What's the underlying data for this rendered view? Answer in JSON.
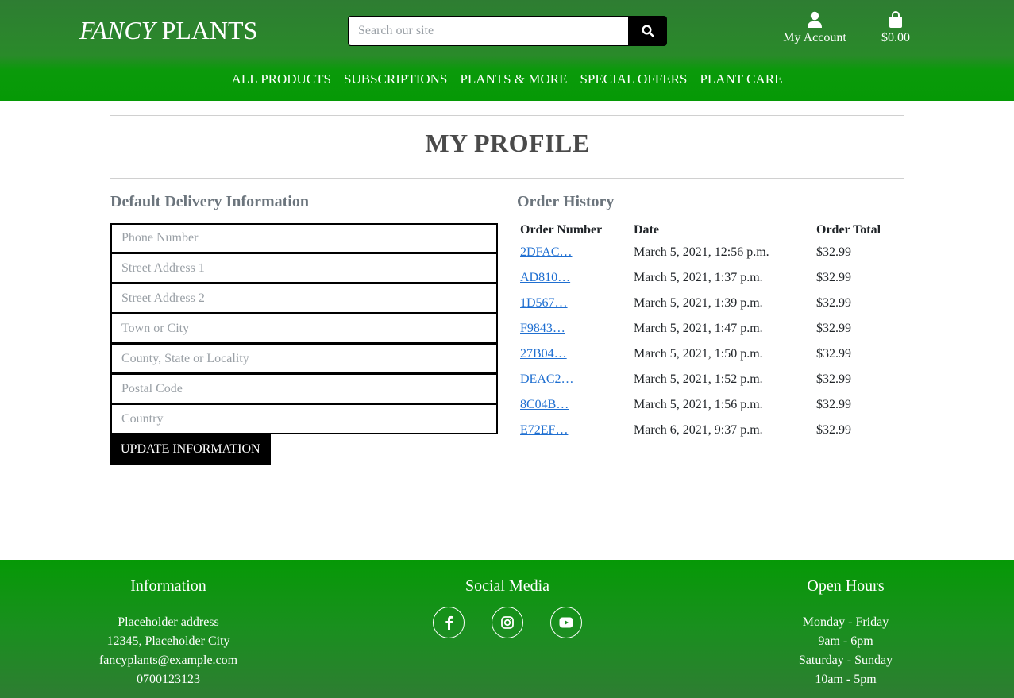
{
  "header": {
    "logo_part1": "FANCY",
    "logo_part2": "PLANTS",
    "search_placeholder": "Search our site",
    "account_label": "My Account",
    "bag_total": "$0.00"
  },
  "nav": [
    "ALL PRODUCTS",
    "SUBSCRIPTIONS",
    "PLANTS & MORE",
    "SPECIAL OFFERS",
    "PLANT CARE"
  ],
  "page": {
    "title": "MY PROFILE",
    "delivery_title": "Default Delivery Information",
    "orders_title": "Order History"
  },
  "form": {
    "phone_placeholder": "Phone Number",
    "street1_placeholder": "Street Address 1",
    "street2_placeholder": "Street Address 2",
    "town_placeholder": "Town or City",
    "county_placeholder": "County, State or Locality",
    "postcode_placeholder": "Postal Code",
    "country_value": "Country",
    "update_label": "UPDATE INFORMATION"
  },
  "orders": {
    "headers": [
      "Order Number",
      "Date",
      "Order Total"
    ],
    "rows": [
      {
        "number": "2DFAC…",
        "date": "March 5, 2021, 12:56 p.m.",
        "total": "$32.99"
      },
      {
        "number": "AD810…",
        "date": "March 5, 2021, 1:37 p.m.",
        "total": "$32.99"
      },
      {
        "number": "1D567…",
        "date": "March 5, 2021, 1:39 p.m.",
        "total": "$32.99"
      },
      {
        "number": "F9843…",
        "date": "March 5, 2021, 1:47 p.m.",
        "total": "$32.99"
      },
      {
        "number": "27B04…",
        "date": "March 5, 2021, 1:50 p.m.",
        "total": "$32.99"
      },
      {
        "number": "DEAC2…",
        "date": "March 5, 2021, 1:52 p.m.",
        "total": "$32.99"
      },
      {
        "number": "8C04B…",
        "date": "March 5, 2021, 1:56 p.m.",
        "total": "$32.99"
      },
      {
        "number": "E72EF…",
        "date": "March 6, 2021, 9:37 p.m.",
        "total": "$32.99"
      }
    ]
  },
  "footer": {
    "info_title": "Information",
    "info_lines": [
      "Placeholder address",
      "12345, Placeholder City",
      "fancyplants@example.com",
      "0700123123"
    ],
    "social_title": "Social Media",
    "social_icons": [
      "facebook-icon",
      "instagram-icon",
      "youtube-icon"
    ],
    "hours_title": "Open Hours",
    "hours_lines": [
      "Monday - Friday",
      "9am - 6pm",
      "Saturday - Sunday",
      "10am - 5pm"
    ]
  },
  "colors": {
    "header_green": "#2e7d32",
    "nav_green": "#069906",
    "link_blue": "#1f6fd1"
  }
}
